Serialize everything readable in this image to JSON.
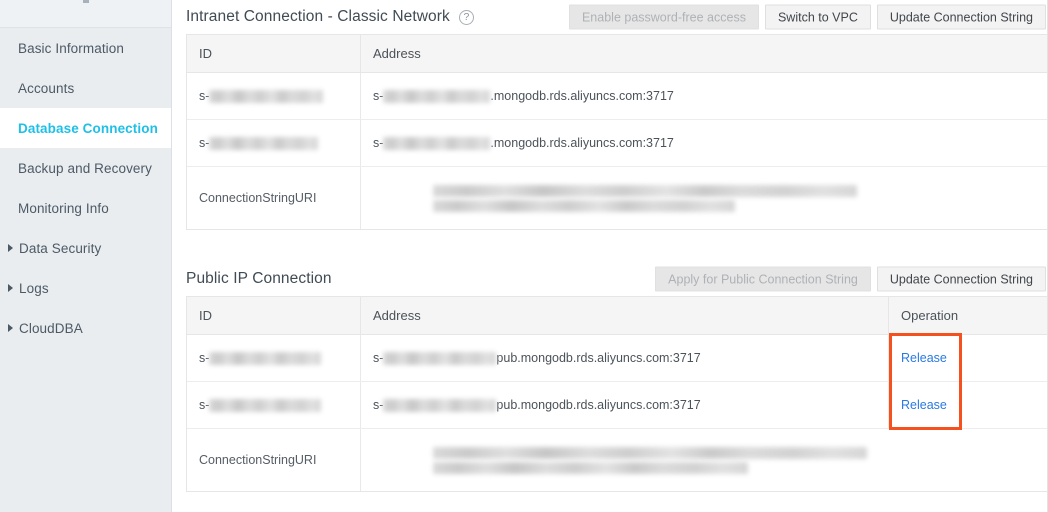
{
  "sidebar": {
    "items": [
      {
        "label": "Basic Information",
        "active": false,
        "expandable": false
      },
      {
        "label": "Accounts",
        "active": false,
        "expandable": false
      },
      {
        "label": "Database Connection",
        "active": true,
        "expandable": false
      },
      {
        "label": "Backup and Recovery",
        "active": false,
        "expandable": false
      },
      {
        "label": "Monitoring Info",
        "active": false,
        "expandable": false
      },
      {
        "label": "Data Security",
        "active": false,
        "expandable": true
      },
      {
        "label": "Logs",
        "active": false,
        "expandable": true
      },
      {
        "label": "CloudDBA",
        "active": false,
        "expandable": true
      }
    ]
  },
  "intranet": {
    "title": "Intranet Connection - Classic Network",
    "help_icon": "question-circle-icon",
    "buttons": [
      {
        "label": "Enable password-free access",
        "disabled": true
      },
      {
        "label": "Switch to VPC",
        "disabled": false
      },
      {
        "label": "Update Connection String",
        "disabled": false
      }
    ],
    "columns": [
      "ID",
      "Address"
    ],
    "rows": [
      {
        "id_prefix": "s-",
        "id_redacted": true,
        "address_prefix": "s-",
        "address_redacted": true,
        "address_suffix": ".mongodb.rds.aliyuncs.com:3717"
      },
      {
        "id_prefix": "s-",
        "id_redacted": true,
        "address_prefix": "s-",
        "address_redacted": true,
        "address_suffix": ".mongodb.rds.aliyuncs.com:3717"
      }
    ],
    "uri_row": {
      "label": "ConnectionStringURI",
      "value_redacted": true
    }
  },
  "public": {
    "title": "Public IP Connection",
    "buttons": [
      {
        "label": "Apply for Public Connection String",
        "disabled": true
      },
      {
        "label": "Update Connection String",
        "disabled": false
      }
    ],
    "columns": [
      "ID",
      "Address",
      "Operation"
    ],
    "rows": [
      {
        "id_prefix": "s-",
        "id_redacted": true,
        "address_prefix": "s-",
        "address_redacted": true,
        "address_suffix": "pub.mongodb.rds.aliyuncs.com:3717",
        "operation": "Release"
      },
      {
        "id_prefix": "s-",
        "id_redacted": true,
        "address_prefix": "s-",
        "address_redacted": true,
        "address_suffix": "pub.mongodb.rds.aliyuncs.com:3717",
        "operation": "Release"
      }
    ],
    "uri_row": {
      "label": "ConnectionStringURI",
      "value_redacted": true
    }
  },
  "annotation": {
    "highlight_color": "#f4511e",
    "target": "operation-release-links"
  },
  "colors": {
    "accent": "#1fc0e8",
    "link": "#2a7ae2",
    "sidebar_bg": "#e9edf0",
    "highlight": "#f4511e"
  }
}
